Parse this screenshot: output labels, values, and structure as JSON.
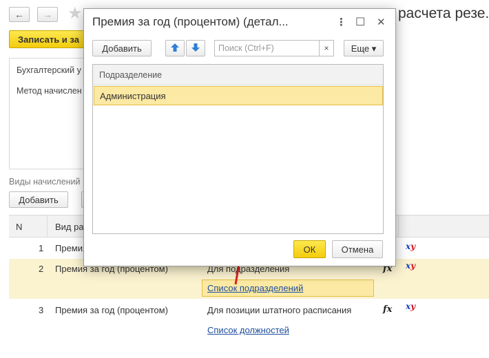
{
  "background": {
    "title_fragment": "расчета резе...",
    "save_button_label": "Записать и за",
    "accounting_label": "Бухгалтерский у",
    "method_label": "Метод начислен",
    "section_label": "Виды начислений",
    "add_button_label": "Добавить",
    "table": {
      "col_n": "N",
      "col_kind": "Вид ра",
      "rows": [
        {
          "n": "1",
          "kind": "Премия",
          "note": "",
          "link": ""
        },
        {
          "n": "2",
          "kind": "Премия за год (процентом)",
          "note": "Для подразделения",
          "link": "Список подразделений"
        },
        {
          "n": "3",
          "kind": "Премия за год (процентом)",
          "note": "Для позиции штатного расписания",
          "link": "Список должностей"
        }
      ],
      "fx_label": "fx",
      "xy_x": "x",
      "xy_y": "y"
    }
  },
  "dialog": {
    "title": "Премия за год (процентом) (детал...",
    "menu_icon": "⋮",
    "maximize_icon": "☐",
    "close_icon": "✕",
    "add_label": "Добавить",
    "search_placeholder": "Поиск (Ctrl+F)",
    "search_clear": "×",
    "more_label": "Еще ▾",
    "column_header": "Подразделение",
    "rows": [
      "Администрация"
    ],
    "ok_label": "ОК",
    "cancel_label": "Отмена"
  },
  "colors": {
    "accent_yellow": "#f3cc0c",
    "selection": "#fbe9a4",
    "link": "#1f4e9c",
    "annotation_arrow": "#e02020",
    "arrow_button_blue": "#2f7fd6"
  }
}
